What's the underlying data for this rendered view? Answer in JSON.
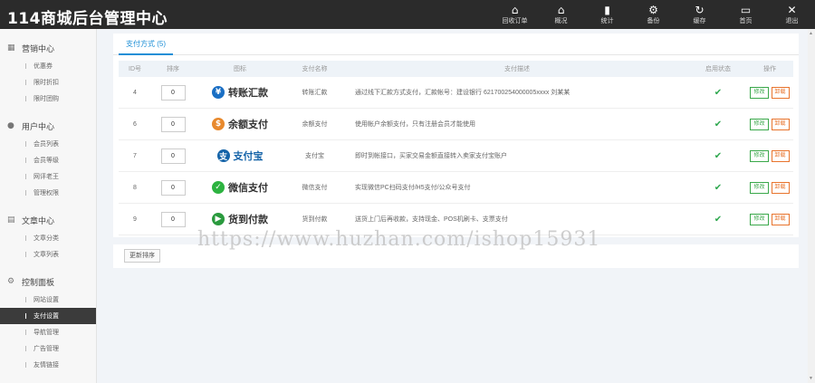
{
  "app": {
    "title": "114商城后台管理中心"
  },
  "nav": [
    {
      "label": "回收订单",
      "icon": "home-icon",
      "glyph": "⌂"
    },
    {
      "label": "概况",
      "icon": "home-icon",
      "glyph": "⌂"
    },
    {
      "label": "统计",
      "icon": "bar-chart-icon",
      "glyph": "▮"
    },
    {
      "label": "备份",
      "icon": "gear-icon",
      "glyph": "⚙"
    },
    {
      "label": "缓存",
      "icon": "refresh-icon",
      "glyph": "↻"
    },
    {
      "label": "首页",
      "icon": "monitor-icon",
      "glyph": "▭"
    },
    {
      "label": "退出",
      "icon": "close-icon",
      "glyph": "✕"
    }
  ],
  "sidebar": [
    {
      "title": "营销中心",
      "icon": "grid-icon",
      "glyph": "▦",
      "items": [
        "优惠券",
        "限时折扣",
        "限时团购"
      ]
    },
    {
      "title": "用户中心",
      "icon": "user-icon",
      "glyph": "●",
      "items": [
        "会员列表",
        "会员等级",
        "网评老王",
        "管理权限"
      ]
    },
    {
      "title": "文章中心",
      "icon": "document-icon",
      "glyph": "▤",
      "items": [
        "文章分类",
        "文章列表"
      ]
    },
    {
      "title": "控制面板",
      "icon": "gear-icon",
      "glyph": "⚙",
      "items": [
        "网站设置",
        "支付设置",
        "导航管理",
        "广告管理",
        "友情链接"
      ]
    }
  ],
  "sidebar_active": "支付设置",
  "tab": {
    "label": "支付方式 (5)"
  },
  "table": {
    "headers": {
      "id": "ID号",
      "sort": "排序",
      "icon": "图标",
      "name": "支付名称",
      "desc": "支付描述",
      "status": "启用状态",
      "ops": "操作"
    },
    "rows": [
      {
        "id": "4",
        "sort": "0",
        "logo": "转账汇款",
        "logo_glyph": "¥",
        "logo_color": "#1a6fc4",
        "name": "转账汇款",
        "desc": "通过线下汇款方式支付，汇款帐号：建设银行 621700254000005xxxx 刘某某",
        "edit": "修改",
        "del": "卸载"
      },
      {
        "id": "6",
        "sort": "0",
        "logo": "余额支付",
        "logo_glyph": "$",
        "logo_color": "#e8892d",
        "name": "余额支付",
        "desc": "使用帐户余额支付，只有注册会员才能使用",
        "edit": "修改",
        "del": "卸载"
      },
      {
        "id": "7",
        "sort": "0",
        "logo": "支付宝",
        "logo_glyph": "支",
        "logo_color": "#1463a8",
        "name": "支付宝",
        "desc": "即时到帐接口，买家交易金额直接转入卖家支付宝账户",
        "edit": "修改",
        "del": "卸载"
      },
      {
        "id": "8",
        "sort": "0",
        "logo": "微信支付",
        "logo_glyph": "✓",
        "logo_color": "#2db340",
        "name": "微信支付",
        "desc": "实现微信PC扫码支付/H5支付/公众号支付",
        "edit": "修改",
        "del": "卸载"
      },
      {
        "id": "9",
        "sort": "0",
        "logo": "货到付款",
        "logo_glyph": "▶",
        "logo_color": "#2a9a3e",
        "name": "货到付款",
        "desc": "送货上门后再收款，支持现金、POS机刷卡、支票支付",
        "edit": "修改",
        "del": "卸载"
      }
    ]
  },
  "footer": {
    "update_label": "更新排序"
  },
  "watermark": "https://www.huzhan.com/ishop15931"
}
